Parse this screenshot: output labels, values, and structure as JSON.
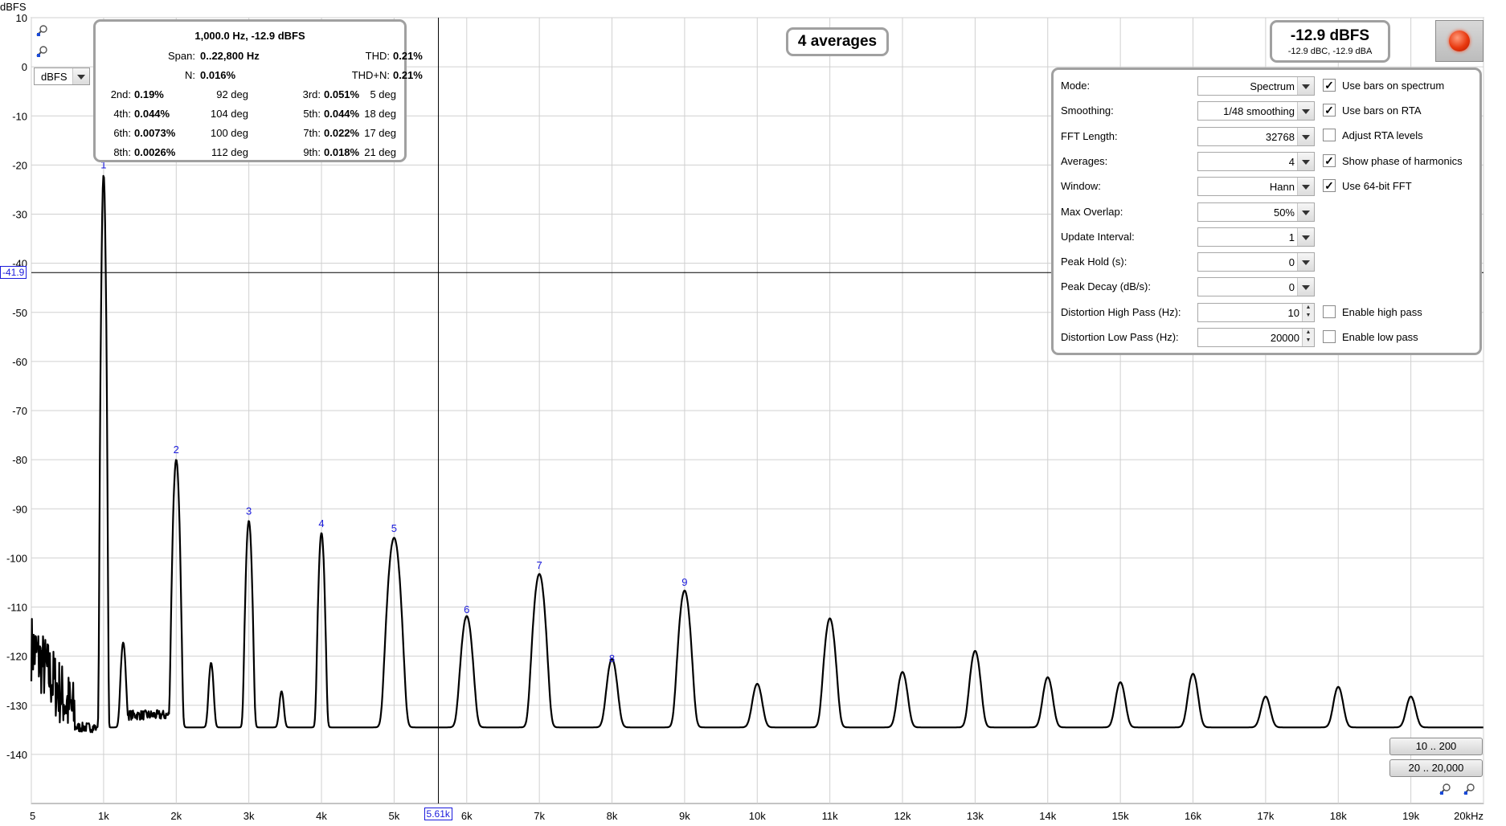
{
  "y_unit_label": "dBFS",
  "unit_select": {
    "value": "dBFS"
  },
  "cursor": {
    "y_readout": "-41.9",
    "x_readout": "5.61k",
    "x_hz": 5610,
    "y_db": -41.9
  },
  "distortion_box": {
    "header": "1,000.0 Hz, -12.9 dBFS",
    "span_label": "Span:",
    "span_value": "0..22,800 Hz",
    "thd_label": "THD:",
    "thd_value": "0.21%",
    "n_label": "N:",
    "n_value": "0.016%",
    "thdn_label": "THD+N:",
    "thdn_value": "0.21%",
    "harmonics": [
      {
        "label": "2nd:",
        "value": "0.19%",
        "phase": "92 deg"
      },
      {
        "label": "3rd:",
        "value": "0.051%",
        "phase": "5 deg"
      },
      {
        "label": "4th:",
        "value": "0.044%",
        "phase": "104 deg"
      },
      {
        "label": "5th:",
        "value": "0.044%",
        "phase": "18 deg"
      },
      {
        "label": "6th:",
        "value": "0.0073%",
        "phase": "100 deg"
      },
      {
        "label": "7th:",
        "value": "0.022%",
        "phase": "17 deg"
      },
      {
        "label": "8th:",
        "value": "0.0026%",
        "phase": "112 deg"
      },
      {
        "label": "9th:",
        "value": "0.018%",
        "phase": "21 deg"
      }
    ]
  },
  "averages_badge": "4 averages",
  "level_box": {
    "main": "-12.9 dBFS",
    "sub": "-12.9 dBC, -12.9 dBA"
  },
  "settings": {
    "rows": [
      {
        "label": "Mode:",
        "value": "Spectrum",
        "kind": "dropdown"
      },
      {
        "label": "Smoothing:",
        "value": "1/48 smoothing",
        "kind": "dropdown"
      },
      {
        "label": "FFT Length:",
        "value": "32768",
        "kind": "dropdown"
      },
      {
        "label": "Averages:",
        "value": "4",
        "kind": "dropdown"
      },
      {
        "label": "Window:",
        "value": "Hann",
        "kind": "dropdown"
      },
      {
        "label": "Max Overlap:",
        "value": "50%",
        "kind": "dropdown"
      },
      {
        "label": "Update Interval:",
        "value": "1",
        "kind": "dropdown"
      },
      {
        "label": "Peak Hold (s):",
        "value": "0",
        "kind": "dropdown"
      },
      {
        "label": "Peak Decay (dB/s):",
        "value": "0",
        "kind": "dropdown"
      },
      {
        "label": "Distortion High Pass (Hz):",
        "value": "10",
        "kind": "spinner"
      },
      {
        "label": "Distortion Low Pass (Hz):",
        "value": "20000",
        "kind": "spinner"
      }
    ],
    "checkboxes": [
      {
        "label": "Use bars on spectrum",
        "checked": true
      },
      {
        "label": "Use bars on RTA",
        "checked": true
      },
      {
        "label": "Adjust RTA levels",
        "checked": false
      },
      {
        "label": "Show phase of harmonics",
        "checked": true
      },
      {
        "label": "Use 64-bit FFT",
        "checked": true
      },
      {
        "label": "Enable high pass",
        "checked": false
      },
      {
        "label": "Enable low pass",
        "checked": false
      }
    ]
  },
  "range_buttons": [
    "10 .. 200",
    "20 .. 20,000"
  ],
  "chart_data": {
    "type": "line",
    "ylabel": "dBFS",
    "xlabel": "",
    "xlim": [
      5,
      20000
    ],
    "ylim": [
      -150,
      10
    ],
    "x_scale": "linear",
    "grid": true,
    "y_ticks": [
      "10",
      "0",
      "-10",
      "-20",
      "-30",
      "-40",
      "-50",
      "-60",
      "-70",
      "-80",
      "-90",
      "-100",
      "-110",
      "-120",
      "-130",
      "-140"
    ],
    "y_tick_values": [
      10,
      0,
      -10,
      -20,
      -30,
      -40,
      -50,
      -60,
      -70,
      -80,
      -90,
      -100,
      -110,
      -120,
      -130,
      -140
    ],
    "x_ticks": [
      "5",
      "1k",
      "2k",
      "3k",
      "4k",
      "5k",
      "6k",
      "7k",
      "8k",
      "9k",
      "10k",
      "11k",
      "12k",
      "13k",
      "14k",
      "15k",
      "16k",
      "17k",
      "18k",
      "19k",
      "20kHz"
    ],
    "x_tick_values": [
      5,
      1000,
      2000,
      3000,
      4000,
      5000,
      6000,
      7000,
      8000,
      9000,
      10000,
      11000,
      12000,
      13000,
      14000,
      15000,
      16000,
      17000,
      18000,
      19000,
      20000
    ],
    "floor_db": -134.5,
    "peaks": [
      {
        "hz": 1000,
        "db": -22,
        "label": "1"
      },
      {
        "hz": 1270,
        "db": -118.5,
        "label": ""
      },
      {
        "hz": 2000,
        "db": -80,
        "label": "2"
      },
      {
        "hz": 2480,
        "db": -123.5,
        "label": ""
      },
      {
        "hz": 3000,
        "db": -92.5,
        "label": "3"
      },
      {
        "hz": 3450,
        "db": -132,
        "label": ""
      },
      {
        "hz": 4000,
        "db": -95,
        "label": "4"
      },
      {
        "hz": 5000,
        "db": -96,
        "label": "5"
      },
      {
        "hz": 6000,
        "db": -112.5,
        "label": "6"
      },
      {
        "hz": 7000,
        "db": -103.5,
        "label": "7"
      },
      {
        "hz": 8000,
        "db": -122.5,
        "label": "8"
      },
      {
        "hz": 9000,
        "db": -107,
        "label": "9"
      },
      {
        "hz": 10000,
        "db": -129.5,
        "label": ""
      },
      {
        "hz": 11000,
        "db": -113,
        "label": ""
      },
      {
        "hz": 12000,
        "db": -126,
        "label": ""
      },
      {
        "hz": 13000,
        "db": -120.5,
        "label": ""
      },
      {
        "hz": 14000,
        "db": -127.5,
        "label": ""
      },
      {
        "hz": 15000,
        "db": -129,
        "label": ""
      },
      {
        "hz": 16000,
        "db": -126.5,
        "label": ""
      },
      {
        "hz": 17000,
        "db": -134,
        "label": ""
      },
      {
        "hz": 18000,
        "db": -130.5,
        "label": ""
      },
      {
        "hz": 19000,
        "db": -134,
        "label": ""
      }
    ]
  }
}
